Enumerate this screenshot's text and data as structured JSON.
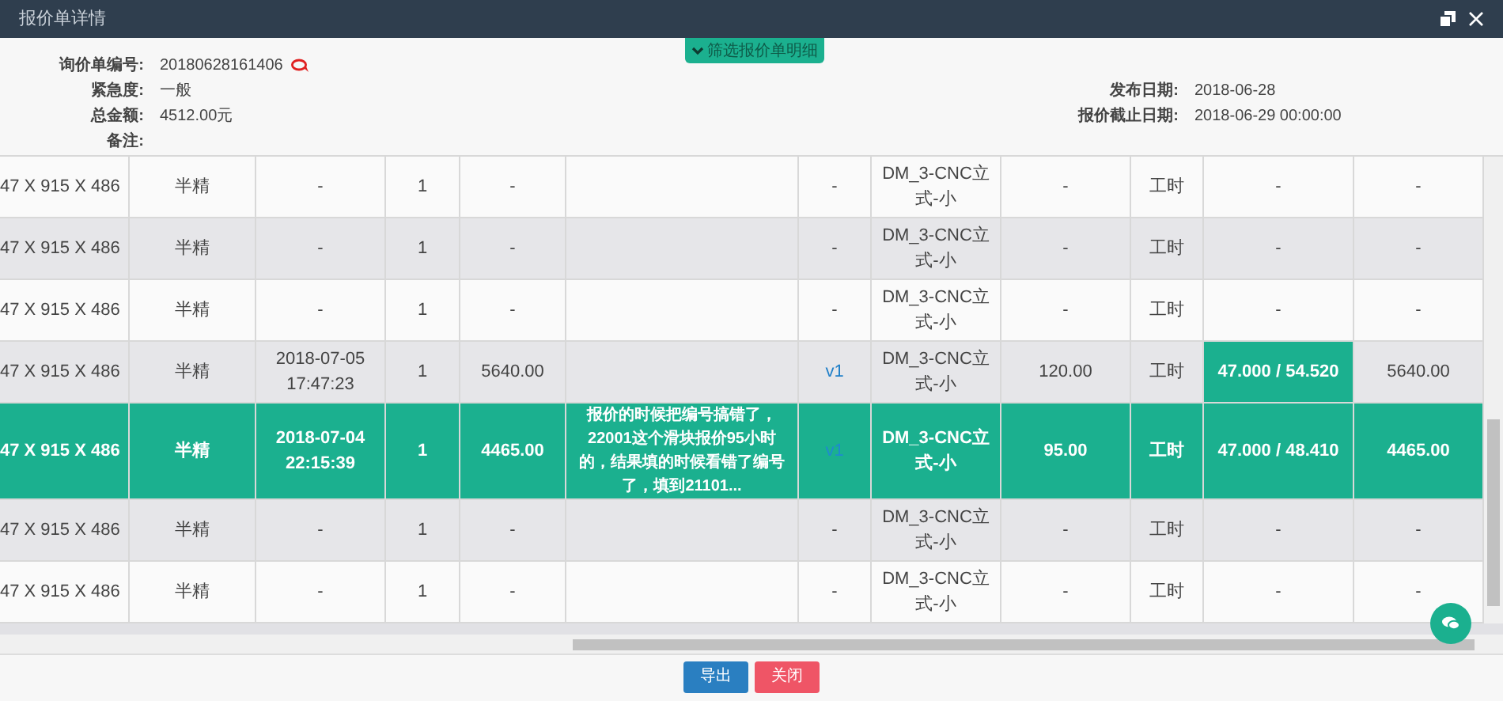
{
  "window": {
    "title": "报价单详情"
  },
  "filter_tab": {
    "label": "筛选报价单明细"
  },
  "info_left": [
    {
      "label": "询价单编号:",
      "value": "20180628161406"
    },
    {
      "label": "紧急度:",
      "value": "一般"
    },
    {
      "label": "总金额:",
      "value": "4512.00元"
    },
    {
      "label": "备注:"
    }
  ],
  "info_right": [
    {
      "label": "发布日期:",
      "value": "2018-06-28"
    },
    {
      "label": "报价截止日期:",
      "value": "2018-06-29 00:00:00"
    }
  ],
  "table": {
    "rows": [
      {
        "selected": false,
        "quote_highlighted": false,
        "cells": [
          "47 X 915 X 486",
          "半精",
          "-",
          "1",
          "-",
          null,
          "-",
          "DM_3-CNC立式-小",
          "-",
          "工时",
          "-",
          "-"
        ]
      },
      {
        "selected": false,
        "quote_highlighted": false,
        "cells": [
          "47 X 915 X 486",
          "半精",
          "-",
          "1",
          "-",
          null,
          "-",
          "DM_3-CNC立式-小",
          "-",
          "工时",
          "-",
          "-"
        ]
      },
      {
        "selected": false,
        "quote_highlighted": false,
        "cells": [
          "47 X 915 X 486",
          "半精",
          "-",
          "1",
          "-",
          null,
          "-",
          "DM_3-CNC立式-小",
          "-",
          "工时",
          "-",
          "-"
        ]
      },
      {
        "selected": false,
        "quote_highlighted": true,
        "cells": [
          "47 X 915 X 486",
          "半精",
          "2018-07-05 17:47:23",
          "1",
          "5640.00",
          null,
          "v1",
          "DM_3-CNC立式-小",
          "120.00",
          "工时",
          "47.000 / 54.520",
          "5640.00"
        ]
      },
      {
        "selected": true,
        "quote_highlighted": true,
        "cells": [
          "47 X 915 X 486",
          "半精",
          "2018-07-04 22:15:39",
          "1",
          "4465.00",
          "报价的时候把编号搞错了，22001这个滑块报价95小时的，结果填的时候看错了编号了，填到21101...",
          "v1",
          "DM_3-CNC立式-小",
          "95.00",
          "工时",
          "47.000 / 48.410",
          "4465.00"
        ]
      },
      {
        "selected": false,
        "quote_highlighted": false,
        "cells": [
          "47 X 915 X 486",
          "半精",
          "-",
          "1",
          "-",
          null,
          "-",
          "DM_3-CNC立式-小",
          "-",
          "工时",
          "-",
          "-"
        ]
      },
      {
        "selected": false,
        "quote_highlighted": false,
        "cells": [
          "47 X 915 X 486",
          "半精",
          "-",
          "1",
          "-",
          null,
          "-",
          "DM_3-CNC立式-小",
          "-",
          "工时",
          "-",
          "-"
        ]
      }
    ]
  },
  "buttons": [
    {
      "kind": "primary",
      "label": "导出"
    },
    {
      "kind": "danger",
      "label": "关闭"
    }
  ]
}
